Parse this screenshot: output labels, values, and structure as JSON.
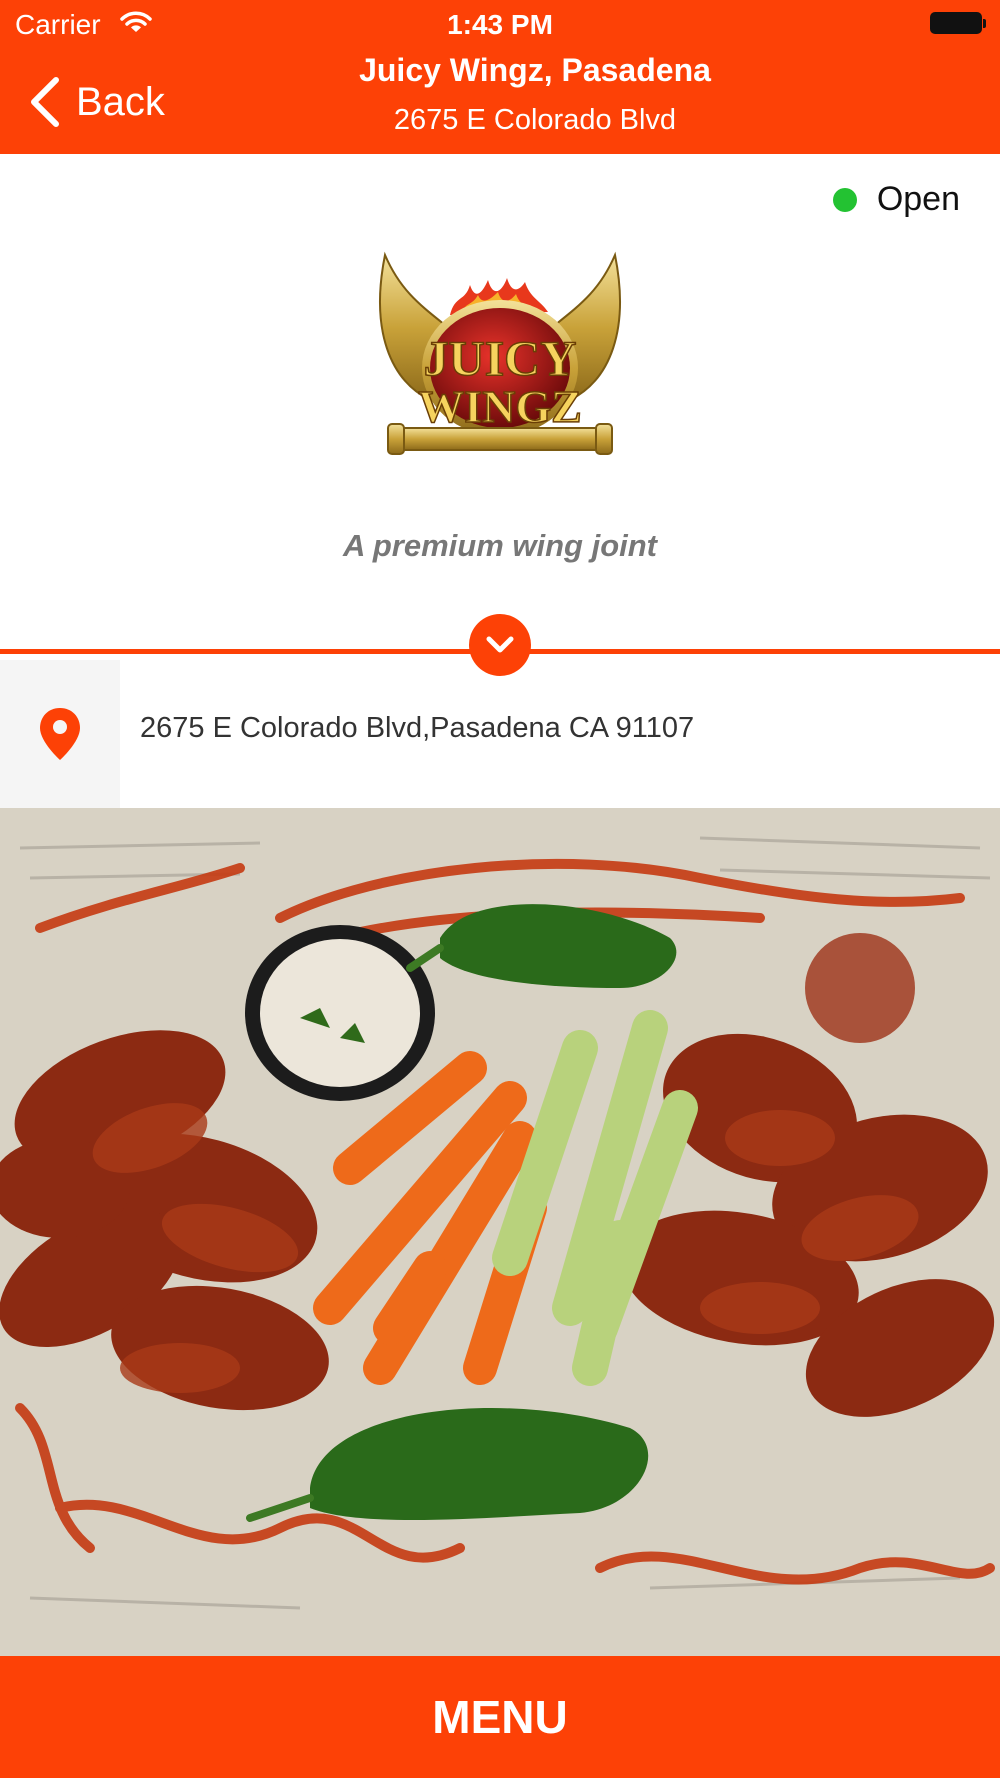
{
  "status_bar": {
    "carrier": "Carrier",
    "time": "1:43 PM"
  },
  "nav": {
    "back_label": "Back",
    "title": "Juicy Wingz, Pasadena",
    "subtitle": "2675 E Colorado Blvd"
  },
  "status": {
    "label": "Open",
    "color": "#23c232"
  },
  "logo": {
    "line1": "JUICY",
    "line2": "WINGZ"
  },
  "tagline": "A premium wing joint",
  "address": "2675 E Colorado Blvd,Pasadena CA 91107",
  "menu_button": "MENU",
  "colors": {
    "brand": "#fd4106"
  },
  "icons": [
    "wifi-icon",
    "battery-icon",
    "back-chevron-icon",
    "chevron-down-icon",
    "location-pin-icon"
  ]
}
